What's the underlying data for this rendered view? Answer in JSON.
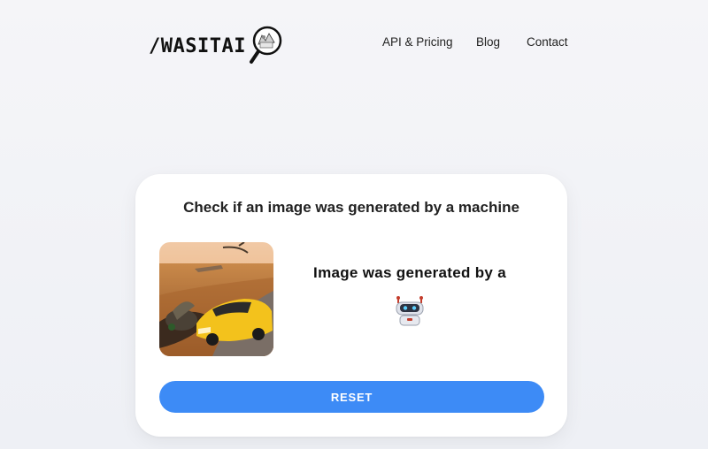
{
  "header": {
    "logo_text": "/WASITAI",
    "nav": {
      "api_pricing": "API & Pricing",
      "blog": "Blog",
      "contact": "Contact"
    }
  },
  "main": {
    "title": "Check if an image was generated by a machine",
    "uploaded_image": {
      "icon": "sports-car-field-image"
    },
    "result": {
      "text": "Image was generated by a",
      "icon": "robot-icon"
    },
    "reset_label": "RESET"
  },
  "colors": {
    "accent": "#3d8bf6",
    "background": "#f2f3f7",
    "card": "#ffffff"
  }
}
